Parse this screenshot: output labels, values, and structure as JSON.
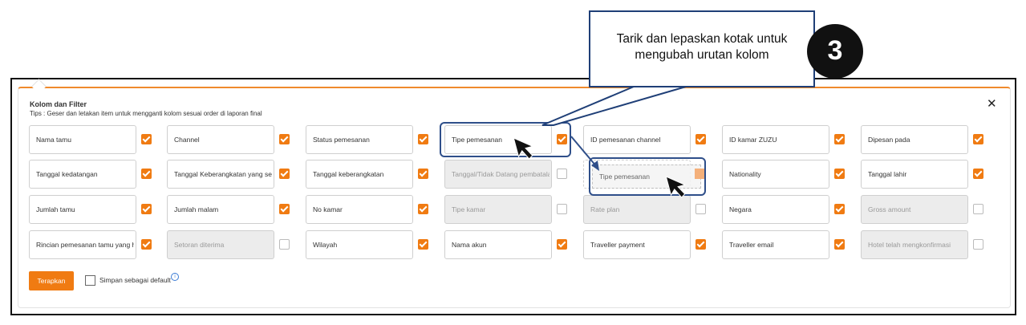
{
  "panel": {
    "title": "Kolom dan Filter",
    "tips": "Tips : Geser dan letakan item untuk mengganti kolom sesuai order di laporan final",
    "close": "✕"
  },
  "columns": [
    {
      "label": "Nama tamu",
      "checked": true,
      "disabled": false
    },
    {
      "label": "Channel",
      "checked": true,
      "disabled": false
    },
    {
      "label": "Status pemesanan",
      "checked": true,
      "disabled": false
    },
    {
      "label": "Tipe pemesanan",
      "checked": true,
      "disabled": false
    },
    {
      "label": "ID pemesanan channel",
      "checked": true,
      "disabled": false
    },
    {
      "label": "ID kamar ZUZU",
      "checked": true,
      "disabled": false
    },
    {
      "label": "Dipesan pada",
      "checked": true,
      "disabled": false
    },
    {
      "label": "Tanggal kedatangan",
      "checked": true,
      "disabled": false
    },
    {
      "label": "Tanggal Keberangkatan yang seb",
      "checked": true,
      "disabled": false
    },
    {
      "label": "Tanggal keberangkatan",
      "checked": true,
      "disabled": false
    },
    {
      "label": "Tanggal/Tidak Datang pembatalan",
      "checked": false,
      "disabled": true
    },
    {
      "label": "",
      "checked": false,
      "disabled": false
    },
    {
      "label": "Nationality",
      "checked": true,
      "disabled": false
    },
    {
      "label": "Tanggal lahir",
      "checked": true,
      "disabled": false
    },
    {
      "label": "Jumlah tamu",
      "checked": true,
      "disabled": false
    },
    {
      "label": "Jumlah malam",
      "checked": true,
      "disabled": false
    },
    {
      "label": "No kamar",
      "checked": true,
      "disabled": false
    },
    {
      "label": "Tipe kamar",
      "checked": false,
      "disabled": true
    },
    {
      "label": "Rate plan",
      "checked": false,
      "disabled": true
    },
    {
      "label": "Negara",
      "checked": true,
      "disabled": false
    },
    {
      "label": "Gross amount",
      "checked": false,
      "disabled": true
    },
    {
      "label": "Rincian pemesanan tamu yang ha",
      "checked": true,
      "disabled": false
    },
    {
      "label": "Setoran diterima",
      "checked": false,
      "disabled": true
    },
    {
      "label": "Wilayah",
      "checked": true,
      "disabled": false
    },
    {
      "label": "Nama akun",
      "checked": true,
      "disabled": false
    },
    {
      "label": "Traveller payment",
      "checked": true,
      "disabled": false
    },
    {
      "label": "Traveller email",
      "checked": true,
      "disabled": false
    },
    {
      "label": "Hotel telah mengkonfirmasi",
      "checked": false,
      "disabled": true
    }
  ],
  "drag_ghost": {
    "label": "Tipe pemesanan"
  },
  "footer": {
    "apply_label": "Terapkan",
    "save_default_label": "Simpan sebagai default",
    "info": "i"
  },
  "annotation": {
    "callout_text": "Tarik dan lepaskan kotak untuk mengubah urutan kolom",
    "step_number": "3"
  },
  "colors": {
    "accent": "#f07b12",
    "highlight": "#2f4f8a"
  }
}
